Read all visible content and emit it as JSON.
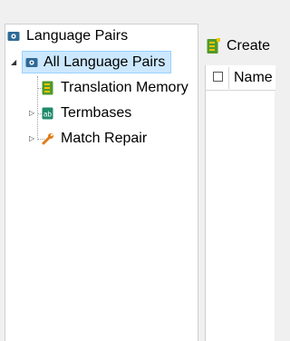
{
  "tree": {
    "root_label": "Language Pairs",
    "items": [
      {
        "label": "All Language Pairs",
        "selected": true,
        "expanded": true
      },
      {
        "label": "Translation Memory"
      },
      {
        "label": "Termbases",
        "expandable": true
      },
      {
        "label": "Match Repair",
        "expandable": true
      }
    ]
  },
  "toolbar": {
    "create_label": "Create"
  },
  "grid": {
    "column_name": "Name"
  },
  "colors": {
    "selection": "#cce8ff",
    "selection_border": "#99d1ff",
    "lang_icon": "#2f6a96",
    "tm_icon": "#4f9a2c",
    "tb_icon": "#1f8a6a",
    "wrench_icon": "#e07b1a"
  }
}
